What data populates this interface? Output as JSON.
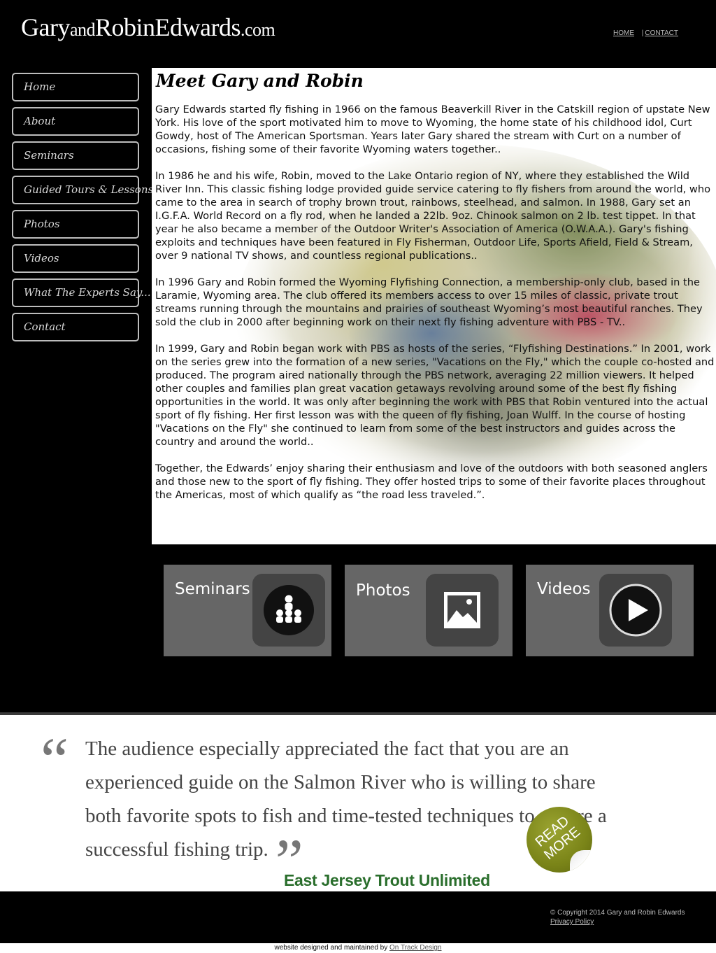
{
  "header": {
    "logo_parts": [
      "Gary",
      "and",
      "Robin",
      "Edwards",
      ".com"
    ],
    "links": [
      {
        "label": "HOME"
      },
      {
        "label": "CONTACT"
      }
    ],
    "separator": "|"
  },
  "nav": {
    "items": [
      {
        "label": "Home"
      },
      {
        "label": "About"
      },
      {
        "label": "Seminars"
      },
      {
        "label": "Guided Tours & Lessons"
      },
      {
        "label": "Photos"
      },
      {
        "label": "Videos"
      },
      {
        "label": "What The Experts Say..."
      },
      {
        "label": "Contact"
      }
    ]
  },
  "main": {
    "title": "Meet Gary and Robin",
    "paragraphs": [
      "Gary Edwards started fly fishing in 1966 on the famous Beaverkill River in the Catskill region of upstate New York. His love of the sport motivated him to move to Wyoming, the home state of his childhood idol, Curt Gowdy, host of The American Sportsman. Years later Gary shared the stream with Curt on a number of occasions, fishing some of their favorite Wyoming waters together..",
      "In 1986 he and his wife, Robin, moved to the Lake Ontario region of NY, where they established the Wild River Inn. This classic fishing lodge provided guide service catering to fly fishers from around the world, who came to the area in search of trophy brown trout, rainbows, steelhead, and salmon. In 1988, Gary set an I.G.F.A. World Record on a fly rod, when he landed a 22lb. 9oz. Chinook salmon on 2 lb. test tippet. In that year he also became a member of the Outdoor Writer's Association of America (O.W.A.A.). Gary's fishing exploits and techniques have been featured in Fly Fisherman, Outdoor Life, Sports Afield, Field & Stream, over 9 national TV shows, and countless regional publications..",
      "In 1996 Gary and Robin formed the Wyoming Flyfishing Connection, a membership-only club, based in the Laramie, Wyoming area. The club offered its members access to over 15 miles of classic, private trout streams running through the mountains and prairies of southeast Wyoming’s most beautiful ranches. They sold the club in 2000 after beginning work on their next fly fishing adventure with PBS - TV..",
      "In 1999, Gary and Robin began work with PBS as hosts of the series, “Flyfishing Destinations.” In 2001, work on the series grew into the formation of a new series, \"Vacations on the Fly,\" which the couple co-hosted and produced. The program aired nationally through the PBS network, averaging 22 million viewers. It helped other couples and families plan great vacation getaways revolving around some of the best fly fishing opportunities in the world. It was only after beginning the work with PBS that Robin ventured into the actual sport of fly fishing. Her first lesson was with the queen of fly fishing, Joan Wulff. In the course of hosting \"Vacations on the Fly\" she continued to learn from some of the best instructors and guides across the country and around the world..",
      "Together, the Edwards’ enjoy sharing their enthusiasm and love of the outdoors with both seasoned anglers and those new to the sport of fly fishing. They offer hosted trips to some of their favorite places throughout the Americas, most of which qualify as “the road less traveled.”."
    ]
  },
  "features": [
    {
      "label": "Seminars",
      "icon": "audience-icon"
    },
    {
      "label": "Photos",
      "icon": "picture-icon"
    },
    {
      "label": "Videos",
      "icon": "play-icon"
    }
  ],
  "testimonial": {
    "open_quote": "“",
    "close_quote": "”",
    "quote": "The audience especially appreciated the fact that you are an experienced guide on the Salmon River who is willing to share both favorite spots to fish and time-tested techniques to ensure a successful fishing trip.",
    "source": "East Jersey Trout Unlimited",
    "read_more_line1": "READ",
    "read_more_line2": "MORE",
    "read_more_color": "#7a8418"
  },
  "footer": {
    "copyright": "© Copyright 2014 Gary and Robin Edwards",
    "privacy": "Privacy Policy",
    "credit_prefix": "website designed and maintained by",
    "credit_link": "On Track Design"
  }
}
